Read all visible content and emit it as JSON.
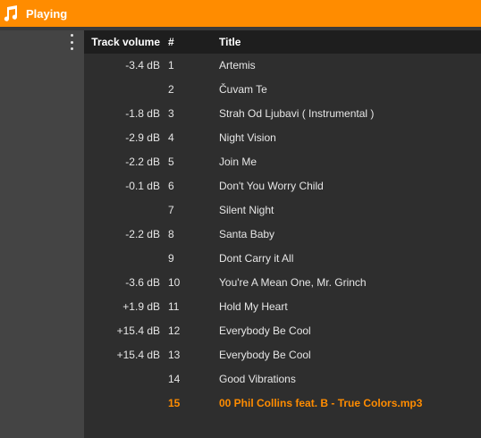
{
  "header": {
    "title": "Playing",
    "icon": "music-note-icon",
    "accent_color": "#ff8c00"
  },
  "columns": {
    "track_volume": "Track volume",
    "number": "#",
    "title": "Title"
  },
  "tracks": [
    {
      "volume": "-3.4 dB",
      "number": "1",
      "title": "Artemis"
    },
    {
      "volume": "",
      "number": "2",
      "title": "Čuvam Te"
    },
    {
      "volume": "-1.8 dB",
      "number": "3",
      "title": "Strah Od Ljubavi ( Instrumental )"
    },
    {
      "volume": "-2.9 dB",
      "number": "4",
      "title": "Night Vision"
    },
    {
      "volume": "-2.2 dB",
      "number": "5",
      "title": "Join Me"
    },
    {
      "volume": "-0.1 dB",
      "number": "6",
      "title": "Don't You Worry Child"
    },
    {
      "volume": "",
      "number": "7",
      "title": "Silent Night"
    },
    {
      "volume": "-2.2 dB",
      "number": "8",
      "title": "Santa Baby"
    },
    {
      "volume": "",
      "number": "9",
      "title": "Dont Carry it All"
    },
    {
      "volume": "-3.6 dB",
      "number": "10",
      "title": "You're A Mean One, Mr. Grinch"
    },
    {
      "volume": "+1.9 dB",
      "number": "11",
      "title": "Hold My Heart"
    },
    {
      "volume": "+15.4 dB",
      "number": "12",
      "title": "Everybody Be Cool"
    },
    {
      "volume": "+15.4 dB",
      "number": "13",
      "title": "Everybody Be Cool"
    },
    {
      "volume": "",
      "number": "14",
      "title": "Good Vibrations"
    },
    {
      "volume": "",
      "number": "15",
      "title": "00 Phil Collins feat. B - True Colors.mp3",
      "active": true
    }
  ]
}
